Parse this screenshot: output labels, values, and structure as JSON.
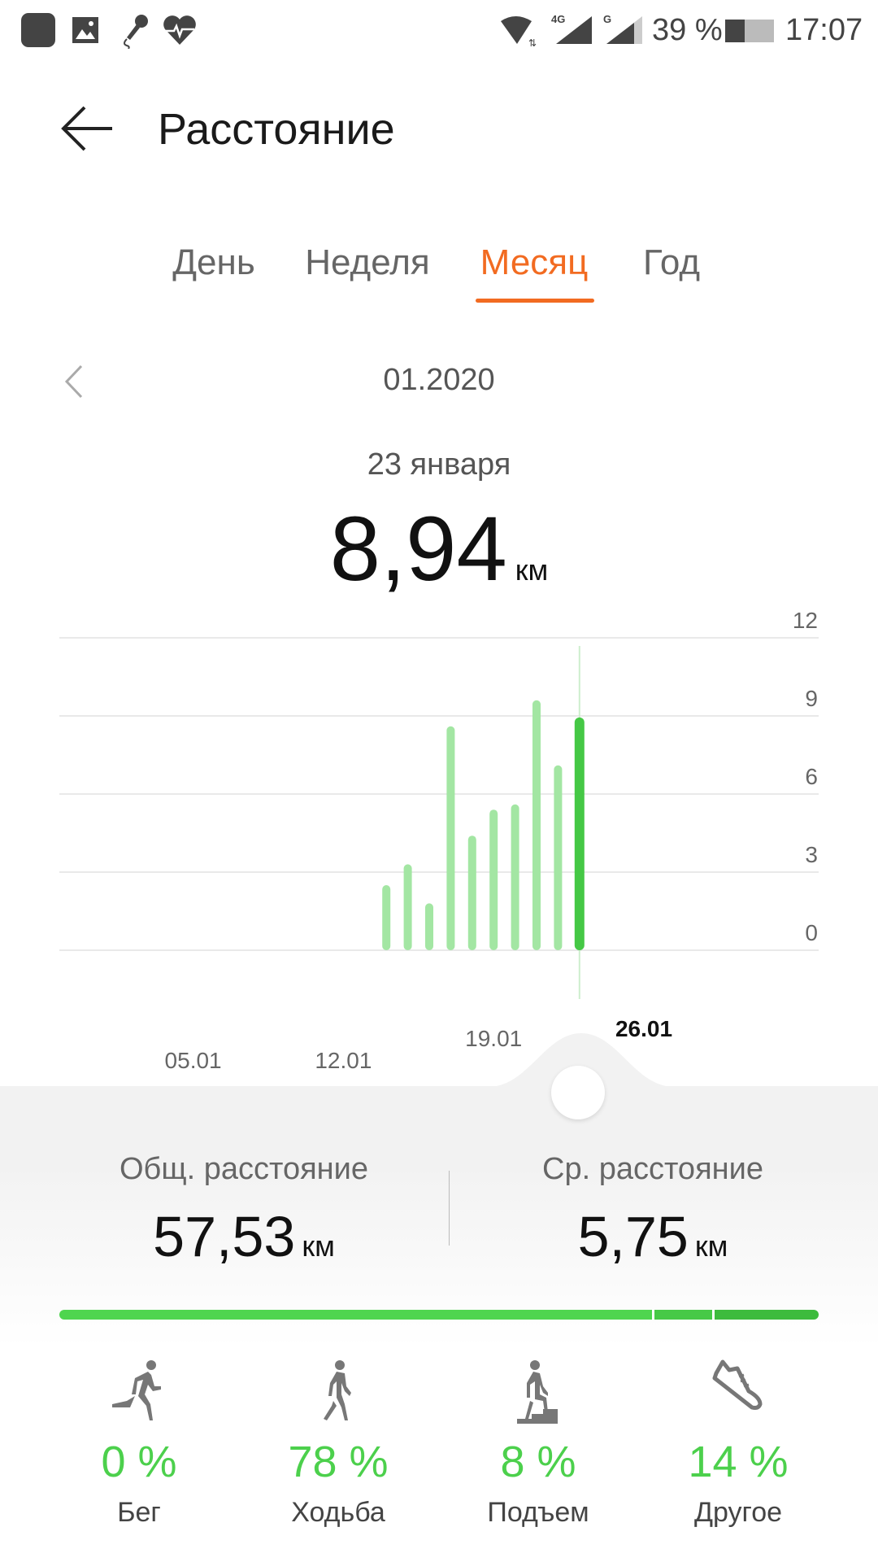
{
  "status_bar": {
    "battery": "39 %",
    "time": "17:07",
    "network_1": "4G",
    "network_2": "G"
  },
  "header": {
    "title": "Расстояние"
  },
  "tabs": [
    {
      "label": "День"
    },
    {
      "label": "Неделя"
    },
    {
      "label": "Месяц",
      "active": true
    },
    {
      "label": "Год"
    }
  ],
  "period": {
    "label": "01.2020"
  },
  "selected": {
    "date": "23 января",
    "value": "8,94",
    "unit": "км"
  },
  "colors": {
    "accent": "#f26b21",
    "bar": "#a3e6a3",
    "bar_selected": "#45c845",
    "progress_walk": "#4fd54f",
    "progress_climb": "#47c947",
    "progress_other": "#3dbb3d"
  },
  "chart_data": {
    "type": "bar",
    "x_ticks": [
      "05.01",
      "12.01",
      "19.01",
      "26.01"
    ],
    "y_ticks": [
      "0",
      "3",
      "6",
      "9",
      "12"
    ],
    "ylim": [
      0,
      12
    ],
    "days_in_month": 31,
    "selected_day": 23,
    "days": [
      14,
      15,
      16,
      17,
      18,
      19,
      20,
      21,
      22,
      23
    ],
    "values": [
      2.5,
      3.3,
      1.8,
      8.6,
      4.4,
      5.4,
      5.6,
      9.6,
      7.1,
      8.94
    ]
  },
  "stats": {
    "total": {
      "label": "Общ. расстояние",
      "value": "57,53",
      "unit": "км"
    },
    "average": {
      "label": "Ср. расстояние",
      "value": "5,75",
      "unit": "км"
    }
  },
  "activities": [
    {
      "name": "Бег",
      "percent": "0 %",
      "value": 0,
      "icon": "running-icon"
    },
    {
      "name": "Ходьба",
      "percent": "78 %",
      "value": 78,
      "icon": "walking-icon"
    },
    {
      "name": "Подъем",
      "percent": "8 %",
      "value": 8,
      "icon": "stairs-climb-icon"
    },
    {
      "name": "Другое",
      "percent": "14 %",
      "value": 14,
      "icon": "sneaker-icon"
    }
  ]
}
